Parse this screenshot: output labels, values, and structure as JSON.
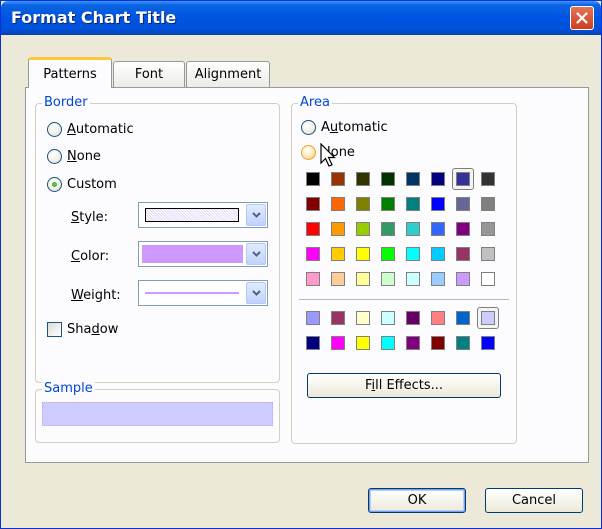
{
  "window": {
    "title": "Format Chart Title"
  },
  "tabs": [
    {
      "label": "Patterns",
      "active": true
    },
    {
      "label": "Font",
      "active": false
    },
    {
      "label": "Alignment",
      "active": false
    }
  ],
  "border": {
    "legend": "Border",
    "options": [
      {
        "label": "Automatic",
        "accel": "A",
        "checked": false
      },
      {
        "label": "None",
        "accel": "N",
        "checked": false
      },
      {
        "label": "Custom",
        "accel": "",
        "checked": true
      }
    ],
    "style_label": "Style:",
    "color_label": "Color:",
    "weight_label": "Weight:",
    "color_value": "#cc99ff",
    "shadow_label": "Shadow"
  },
  "sample": {
    "legend": "Sample",
    "fill": "#ccccff"
  },
  "area": {
    "legend": "Area",
    "options": [
      {
        "label": "Automatic",
        "checked": false
      },
      {
        "label": "None",
        "checked": false,
        "hover": true
      }
    ],
    "palette": [
      [
        "#000000",
        "#993300",
        "#333300",
        "#003300",
        "#003366",
        "#000080",
        "#333399",
        "#333333"
      ],
      [
        "#800000",
        "#FF6600",
        "#808000",
        "#008000",
        "#008080",
        "#0000FF",
        "#666699",
        "#808080"
      ],
      [
        "#FF0000",
        "#FF9900",
        "#99CC00",
        "#339966",
        "#33CCCC",
        "#3366FF",
        "#800080",
        "#969696"
      ],
      [
        "#FF00FF",
        "#FFCC00",
        "#FFFF00",
        "#00FF00",
        "#00FFFF",
        "#00CCFF",
        "#993366",
        "#C0C0C0"
      ],
      [
        "#FF99CC",
        "#FFCC99",
        "#FFFF99",
        "#CCFFCC",
        "#CCFFFF",
        "#99CCFF",
        "#CC99FF",
        "#FFFFFF"
      ]
    ],
    "chart_palette": [
      [
        "#9999FF",
        "#993366",
        "#FFFFCC",
        "#CCFFFF",
        "#660066",
        "#FF8080",
        "#0066CC",
        "#CCCCFF"
      ],
      [
        "#000080",
        "#FF00FF",
        "#FFFF00",
        "#00FFFF",
        "#800080",
        "#800000",
        "#008080",
        "#0000FF"
      ]
    ],
    "selected_main": [
      0,
      6
    ],
    "selected_chart": [
      0,
      7
    ],
    "fill_effects_label": "Fill Effects..."
  },
  "buttons": {
    "ok": "OK",
    "cancel": "Cancel"
  }
}
